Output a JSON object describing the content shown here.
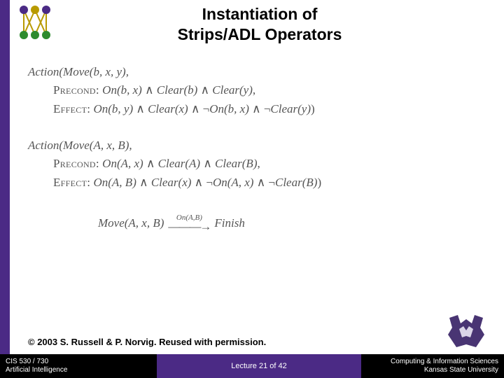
{
  "title_line1": "Instantiation of",
  "title_line2": "Strips/ADL Operators",
  "block1": {
    "action": "Action(Move(b, x, y),",
    "precond": "PRECOND: On(b, x) ∧ Clear(b) ∧ Clear(y),",
    "effect": "EFFECT: On(b, y) ∧ Clear(x) ∧ ¬On(b, x) ∧ ¬Clear(y))"
  },
  "block2": {
    "action": "Action(Move(A, x, B),",
    "precond": "PRECOND: On(A, x) ∧ Clear(A) ∧ Clear(B),",
    "effect": "EFFECT: On(A, B) ∧ Clear(x) ∧ ¬On(A, x) ∧ ¬Clear(B))"
  },
  "finish": {
    "left": "Move(A, x, B)",
    "over": "On(A,B)",
    "right": "Finish"
  },
  "credit": "© 2003 S. Russell & P. Norvig.  Reused with permission.",
  "footer": {
    "left1": "CIS 530 / 730",
    "left2": "Artificial Intelligence",
    "center": "Lecture 21 of 42",
    "right1": "Computing & Information Sciences",
    "right2": "Kansas State University"
  }
}
